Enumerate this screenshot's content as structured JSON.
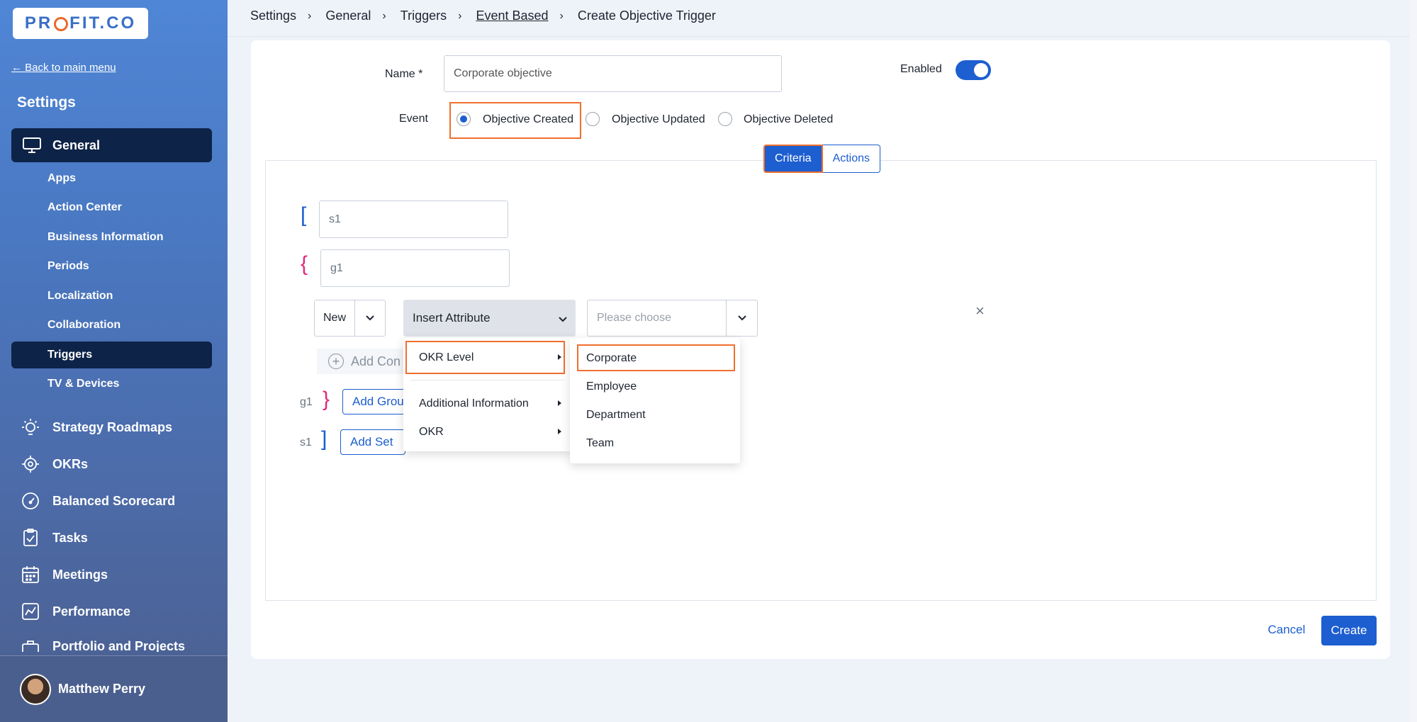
{
  "sidebar": {
    "logo": "PROFIT.CO",
    "back_link": "← Back to main menu",
    "title": "Settings",
    "general_label": "General",
    "general_items": [
      "Apps",
      "Action Center",
      "Business Information",
      "Periods",
      "Localization",
      "Collaboration",
      "Triggers",
      "TV & Devices"
    ],
    "modules": [
      "Strategy Roadmaps",
      "OKRs",
      "Balanced Scorecard",
      "Tasks",
      "Meetings",
      "Performance",
      "Portfolio and Projects"
    ],
    "user_name": "Matthew Perry"
  },
  "breadcrumb": [
    "Settings",
    "General",
    "Triggers",
    "Event Based",
    "Create Objective Trigger"
  ],
  "form": {
    "name_label": "Name *",
    "name_value": "Corporate objective",
    "enabled_label": "Enabled",
    "enabled": true,
    "event_label": "Event",
    "events": [
      "Objective Created",
      "Objective Updated",
      "Objective Deleted"
    ],
    "selected_event": "Objective Created"
  },
  "tabs": [
    "Criteria",
    "Actions"
  ],
  "active_tab": "Criteria",
  "criteria": {
    "set_bracket_open": "[",
    "group_bracket_open": "{",
    "set_name": "s1",
    "group_name": "g1",
    "new_label": "New",
    "insert_attribute": "Insert Attribute",
    "choose_placeholder": "Please choose",
    "add_condition": "Add Con",
    "group_bracket_close": "}",
    "set_bracket_close": "]",
    "add_group": "Add Grou",
    "add_set": "Add Set",
    "close": "×"
  },
  "attribute_menu": [
    "OKR Level",
    "Additional Information",
    "OKR"
  ],
  "okr_level_menu": [
    "Corporate",
    "Employee",
    "Department",
    "Team"
  ],
  "footer": {
    "cancel": "Cancel",
    "create": "Create"
  },
  "colors": {
    "primary": "#1d5ed0",
    "highlight": "#ef6f2e",
    "sidebar_active": "#0d2347",
    "pink": "#e2287a"
  }
}
